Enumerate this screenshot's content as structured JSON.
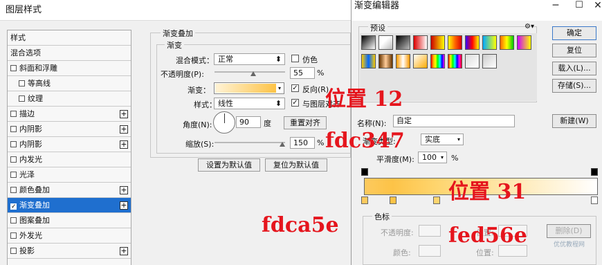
{
  "left_window": {
    "title": "图层样式",
    "styles": [
      {
        "label": "样式",
        "checkbox": false,
        "plus": false,
        "indent": false,
        "selected": false
      },
      {
        "label": "混合选项",
        "checkbox": false,
        "plus": false,
        "indent": false,
        "selected": false
      },
      {
        "label": "斜面和浮雕",
        "checkbox": true,
        "plus": false,
        "indent": false,
        "selected": false
      },
      {
        "label": "等高线",
        "checkbox": true,
        "plus": false,
        "indent": true,
        "selected": false
      },
      {
        "label": "纹理",
        "checkbox": true,
        "plus": false,
        "indent": true,
        "selected": false
      },
      {
        "label": "描边",
        "checkbox": true,
        "plus": true,
        "indent": false,
        "selected": false
      },
      {
        "label": "内阴影",
        "checkbox": true,
        "plus": true,
        "indent": false,
        "selected": false
      },
      {
        "label": "内阴影",
        "checkbox": true,
        "plus": true,
        "indent": false,
        "selected": false
      },
      {
        "label": "内发光",
        "checkbox": true,
        "plus": false,
        "indent": false,
        "selected": false
      },
      {
        "label": "光泽",
        "checkbox": true,
        "plus": false,
        "indent": false,
        "selected": false
      },
      {
        "label": "颜色叠加",
        "checkbox": true,
        "plus": true,
        "indent": false,
        "selected": false
      },
      {
        "label": "渐变叠加",
        "checkbox": true,
        "plus": true,
        "indent": false,
        "selected": true
      },
      {
        "label": "图案叠加",
        "checkbox": true,
        "plus": false,
        "indent": false,
        "selected": false
      },
      {
        "label": "外发光",
        "checkbox": true,
        "plus": false,
        "indent": false,
        "selected": false
      },
      {
        "label": "投影",
        "checkbox": true,
        "plus": true,
        "indent": false,
        "selected": false
      }
    ],
    "panel": {
      "group_title": "渐变叠加",
      "sub_title": "渐变",
      "blend_mode_label": "混合模式：",
      "blend_mode_value": "正常",
      "dither_label": "仿色",
      "dither_checked": false,
      "opacity_label": "不透明度(P):",
      "opacity_value": "55",
      "opacity_level": 55,
      "percent": "%",
      "gradient_label": "渐变：",
      "reverse_label": "反向(R)",
      "reverse_checked": true,
      "style_label": "样式：",
      "style_value": "线性",
      "align_label": "与图层对齐",
      "align_checked": true,
      "angle_label": "角度(N):",
      "angle_value": "90",
      "degree_unit": "度",
      "reset_align_button": "重置对齐",
      "scale_label": "缩放(S):",
      "scale_value": "150",
      "scale_level": 100,
      "set_default_button": "设置为默认值",
      "reset_default_button": "复位为默认值"
    }
  },
  "right_window": {
    "title": "渐变编辑器",
    "presets_label": "预设",
    "buttons": {
      "ok": "确定",
      "reset": "复位",
      "load": "载入(L)...",
      "save": "存储(S)...",
      "new": "新建(W)"
    },
    "name_label": "名称(N):",
    "name_value": "自定",
    "gradient_type_label": "渐变类型:",
    "gradient_type_value": "实底",
    "smoothness_label": "平滑度(M):",
    "smoothness_value": "100",
    "percent": "%",
    "color_stops_group": "色标",
    "opacity_label": "不透明度:",
    "location_label": "位置:",
    "color_label": "颜色:",
    "delete_button": "删除(D)"
  },
  "colors": {
    "gradient_start": "#fdca5e",
    "gradient_mid": "#fdc347",
    "gradient_end": "#fed56e",
    "selection": "#1f6fcf",
    "annotation": "#e5151d"
  },
  "annotations": {
    "position_12": "位置 12",
    "hex_fdc347": "fdc347",
    "position_31": "位置 31",
    "hex_fdca5e": "fdca5e",
    "hex_fed56e": "fed56e"
  },
  "watermark": "优优教程网"
}
